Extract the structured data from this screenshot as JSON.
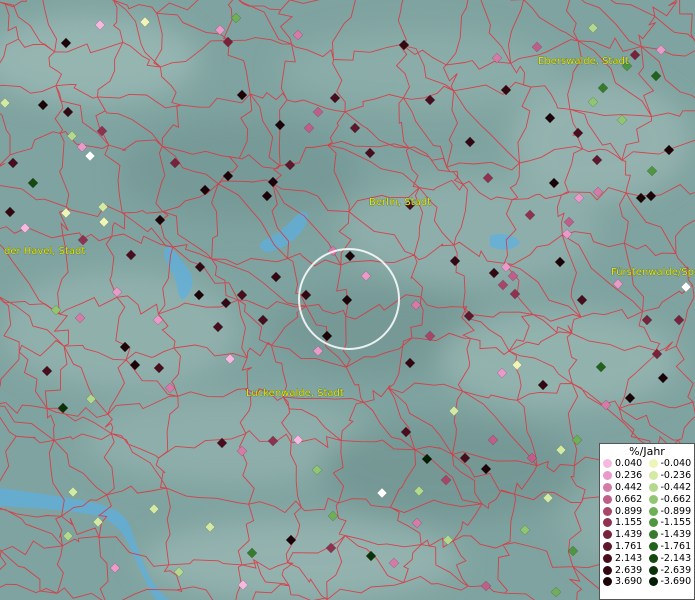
{
  "labels": {
    "eberswalde": "Eberswalde, Stadt",
    "berlin": "Berlin, Stadt",
    "havel": "der Havel, Stadt",
    "fuerstenwalde": "Fürstenwalde/Spr",
    "luckenwalde": "Luckenwalde, Stadt"
  },
  "legend": {
    "title": "%/Jahr",
    "positive": [
      {
        "value": "0.040",
        "color": "#f7b8e0"
      },
      {
        "value": "0.236",
        "color": "#e99ac8"
      },
      {
        "value": "0.442",
        "color": "#d67aa8"
      },
      {
        "value": "0.662",
        "color": "#c05e8a"
      },
      {
        "value": "0.899",
        "color": "#a84669"
      },
      {
        "value": "1.155",
        "color": "#8e3250"
      },
      {
        "value": "1.439",
        "color": "#76233c"
      },
      {
        "value": "1.761",
        "color": "#5e172b"
      },
      {
        "value": "2.143",
        "color": "#480e1e"
      },
      {
        "value": "2.639",
        "color": "#330812"
      },
      {
        "value": "3.690",
        "color": "#1c0308"
      }
    ],
    "negative": [
      {
        "value": "-0.040",
        "color": "#eef5b8"
      },
      {
        "value": "-0.236",
        "color": "#d2eaa4"
      },
      {
        "value": "-0.442",
        "color": "#b2d98c"
      },
      {
        "value": "-0.662",
        "color": "#90c672"
      },
      {
        "value": "-0.899",
        "color": "#6eaf58"
      },
      {
        "value": "-1.155",
        "color": "#4f9640"
      },
      {
        "value": "-1.439",
        "color": "#367c2c"
      },
      {
        "value": "-1.761",
        "color": "#22621c"
      },
      {
        "value": "-2.143",
        "color": "#144a10"
      },
      {
        "value": "-2.639",
        "color": "#0a3408"
      },
      {
        "value": "-3.690",
        "color": "#031e03"
      }
    ]
  },
  "colors": {
    "boundary": "#e0303a",
    "water": "#58b0e8",
    "label": "#e6e600"
  }
}
